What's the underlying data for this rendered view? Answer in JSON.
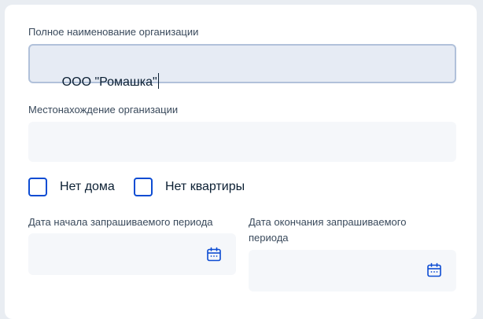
{
  "org_name": {
    "label": "Полное наименование организации",
    "value": "ООО \"Ромашка\""
  },
  "org_location": {
    "label": "Местонахождение организации",
    "value": ""
  },
  "checkboxes": [
    {
      "label": "Нет дома",
      "checked": false
    },
    {
      "label": "Нет квартиры",
      "checked": false
    }
  ],
  "period_start": {
    "label": "Дата начала запрашиваемого периода",
    "value": "",
    "icon": "calendar-icon"
  },
  "period_end": {
    "label": "Дата окончания запрашиваемого периода",
    "value": "",
    "icon": "calendar-icon"
  },
  "colors": {
    "accent": "#0d4cd3",
    "field_bg": "#f5f7fa",
    "focused_field_bg": "#e6ebf4",
    "text": "#0b1f33",
    "label_text": "#3a4a5c"
  }
}
